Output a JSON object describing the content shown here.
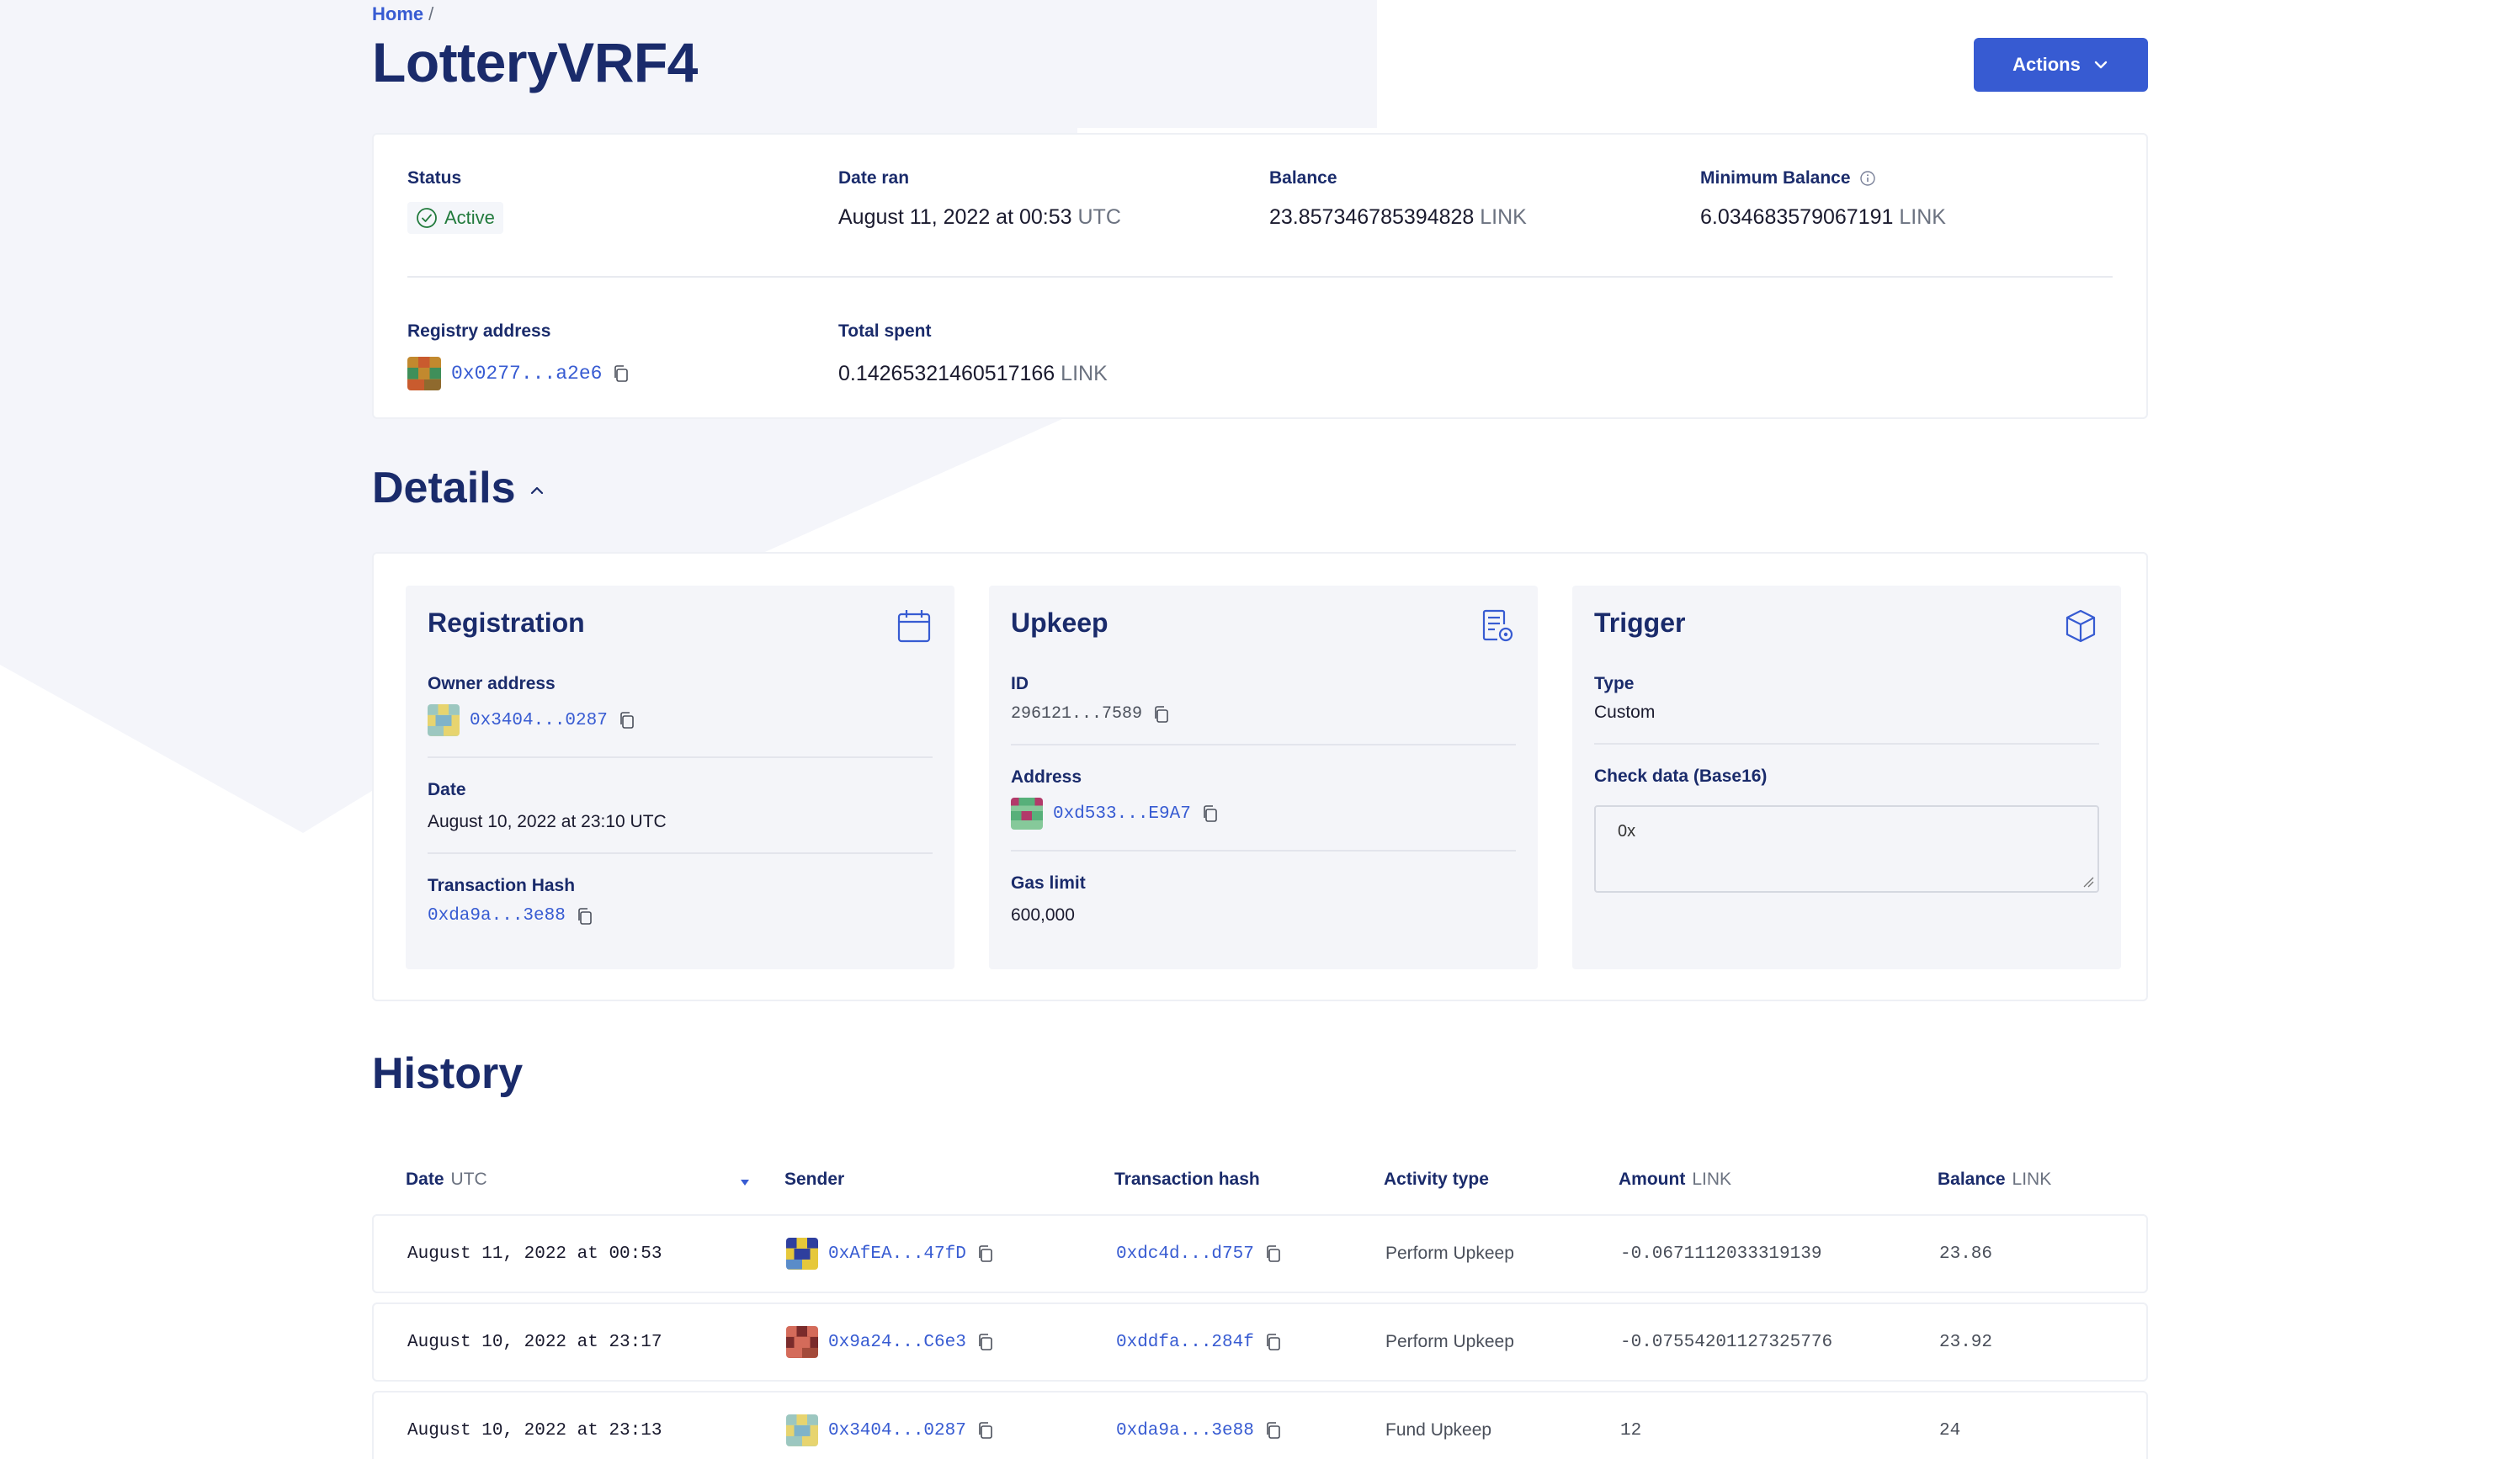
{
  "breadcrumb": {
    "home": "Home",
    "separator": "/"
  },
  "page": {
    "title": "LotteryVRF4"
  },
  "actions": {
    "label": "Actions",
    "icon": "chevron-down-icon"
  },
  "summary": {
    "status": {
      "label": "Status",
      "value": "Active",
      "icon": "check-circle-icon",
      "color": "#217a3c"
    },
    "date_ran": {
      "label": "Date ran",
      "value": "August 11, 2022 at 00:53",
      "unit": "UTC"
    },
    "balance": {
      "label": "Balance",
      "value": "23.857346785394828",
      "unit": "LINK"
    },
    "min_balance": {
      "label": "Minimum Balance",
      "value": "6.034683579067191",
      "unit": "LINK",
      "icon": "info-icon"
    },
    "registry": {
      "label": "Registry address",
      "value": "0x0277...a2e6"
    },
    "total_spent": {
      "label": "Total spent",
      "value": "0.14265321460517166",
      "unit": "LINK"
    }
  },
  "details": {
    "title": "Details",
    "registration": {
      "title": "Registration",
      "icon": "calendar-icon",
      "owner_label": "Owner address",
      "owner_value": "0x3404...0287",
      "date_label": "Date",
      "date_value": "August 10, 2022 at 23:10 UTC",
      "tx_label": "Transaction Hash",
      "tx_value": "0xda9a...3e88"
    },
    "upkeep": {
      "title": "Upkeep",
      "icon": "document-settings-icon",
      "id_label": "ID",
      "id_value": "296121...7589",
      "address_label": "Address",
      "address_value": "0xd533...E9A7",
      "gas_label": "Gas limit",
      "gas_value": "600,000"
    },
    "trigger": {
      "title": "Trigger",
      "icon": "cube-icon",
      "type_label": "Type",
      "type_value": "Custom",
      "check_label": "Check data (Base16)",
      "check_value": "0x"
    }
  },
  "history": {
    "title": "History",
    "columns": {
      "date": "Date",
      "date_unit": "UTC",
      "sender": "Sender",
      "tx": "Transaction hash",
      "activity": "Activity type",
      "amount": "Amount",
      "amount_unit": "LINK",
      "balance": "Balance",
      "balance_unit": "LINK"
    },
    "rows": [
      {
        "date": "August 11, 2022 at 00:53",
        "sender": "0xAfEA...47fD",
        "tx": "0xdc4d...d757",
        "activity": "Perform Upkeep",
        "amount": "-0.0671112033319139",
        "balance": "23.86"
      },
      {
        "date": "August 10, 2022 at 23:17",
        "sender": "0x9a24...C6e3",
        "tx": "0xddfa...284f",
        "activity": "Perform Upkeep",
        "amount": "-0.07554201127325776",
        "balance": "23.92"
      },
      {
        "date": "August 10, 2022 at 23:13",
        "sender": "0x3404...0287",
        "tx": "0xda9a...3e88",
        "activity": "Fund Upkeep",
        "amount": "12",
        "balance": "24"
      }
    ]
  },
  "colors": {
    "brand": "#375bd2",
    "title": "#1a2b6b",
    "active": "#217a3c"
  }
}
